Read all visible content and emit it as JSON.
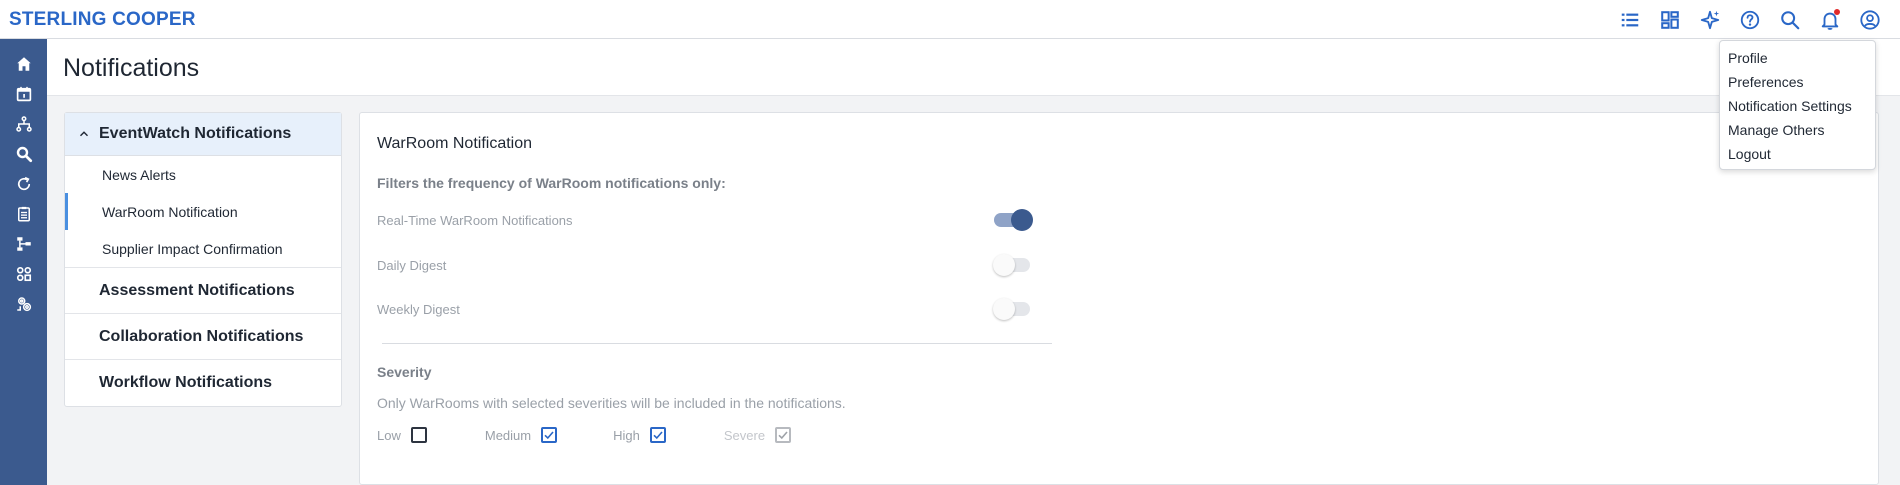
{
  "brand": "STERLING COOPER",
  "top_icons": [
    "list-icon",
    "dashboard-icon",
    "sparkle-icon",
    "help-icon",
    "search-icon",
    "bell-icon",
    "user-icon"
  ],
  "rail_icons": [
    "home-icon",
    "calendar-icon",
    "hierarchy-icon",
    "search-zoom-icon",
    "refresh-icon",
    "clipboard-icon",
    "flow-icon",
    "apps-icon",
    "settings-icon"
  ],
  "page": {
    "title": "Notifications"
  },
  "sidemenu": {
    "expanded_group": "EventWatch Notifications",
    "sub_items": [
      {
        "label": "News Alerts",
        "active": false
      },
      {
        "label": "WarRoom Notification",
        "active": true
      },
      {
        "label": "Supplier Impact Confirmation",
        "active": false
      }
    ],
    "groups": [
      "Assessment Notifications",
      "Collaboration Notifications",
      "Workflow Notifications"
    ]
  },
  "panel": {
    "title": "WarRoom Notification",
    "subtitle": "Filters the frequency of WarRoom notifications only:",
    "toggles": [
      {
        "label": "Real-Time WarRoom Notifications",
        "on": true
      },
      {
        "label": "Daily Digest",
        "on": false
      },
      {
        "label": "Weekly Digest",
        "on": false
      }
    ],
    "severity_title": "Severity",
    "severity_desc": "Only WarRooms with selected severities will be included in the notifications.",
    "severities": [
      {
        "label": "Low",
        "checked": false,
        "disabled": false
      },
      {
        "label": "Medium",
        "checked": true,
        "disabled": false
      },
      {
        "label": "High",
        "checked": true,
        "disabled": false
      },
      {
        "label": "Severe",
        "checked": true,
        "disabled": true
      }
    ]
  },
  "user_menu": [
    "Profile",
    "Preferences",
    "Notification Settings",
    "Manage Others",
    "Logout"
  ],
  "colors": {
    "brand": "#2a67c7",
    "rail": "#3b5a8e",
    "accent": "#4a8fe0"
  }
}
